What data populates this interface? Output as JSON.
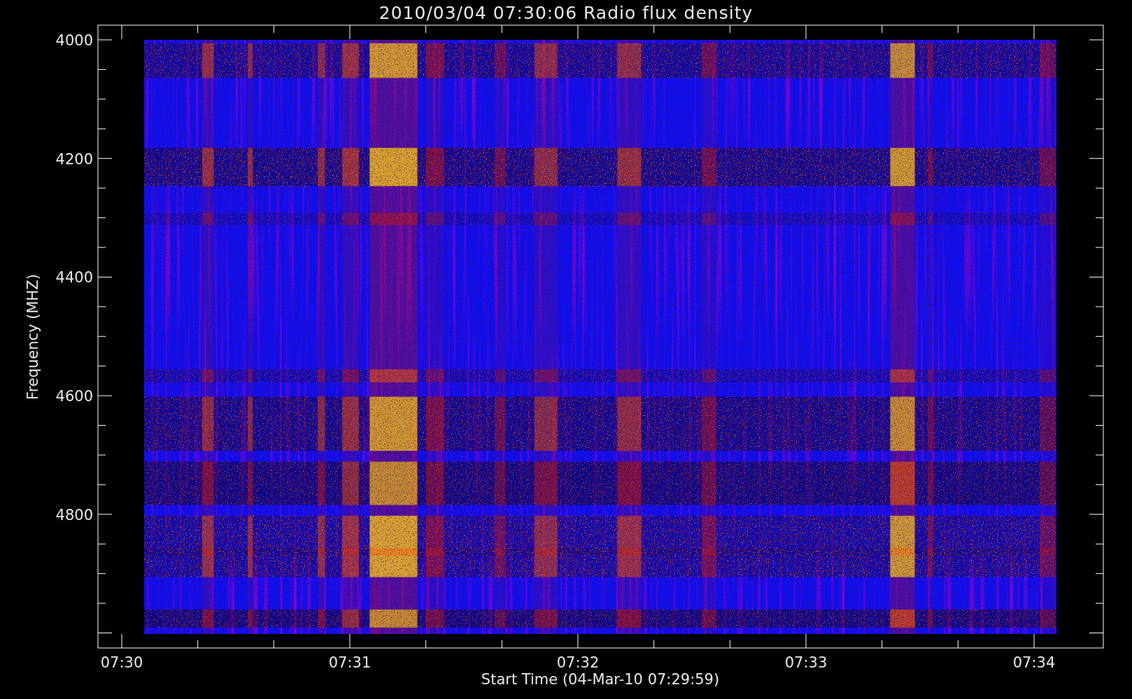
{
  "title": "2010/03/04 07:30:06 Radio flux density",
  "y_axis": {
    "label": "Frequency (MHZ)",
    "ticks": [
      "4000",
      "4200",
      "4400",
      "4600",
      "4800"
    ]
  },
  "x_axis": {
    "label": "Start Time (04-Mar-10 07:29:59)",
    "ticks": [
      "07:30",
      "07:31",
      "07:32",
      "07:33",
      "07:34"
    ]
  }
}
